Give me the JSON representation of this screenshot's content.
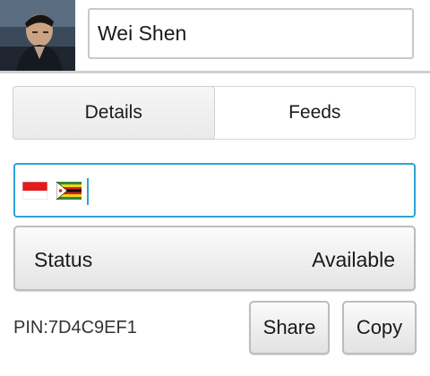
{
  "profile": {
    "name": "Wei Shen"
  },
  "tabs": [
    {
      "label": "Details",
      "active": true
    },
    {
      "label": "Feeds",
      "active": false
    }
  ],
  "pin_input": {
    "flags": [
      "indonesia-flag-icon",
      "zimbabwe-flag-icon"
    ],
    "accent_color": "#2ea3d6"
  },
  "status": {
    "label": "Status",
    "value": "Available"
  },
  "pin": "PIN:7D4C9EF1",
  "actions": {
    "share_label": "Share",
    "copy_label": "Copy"
  }
}
